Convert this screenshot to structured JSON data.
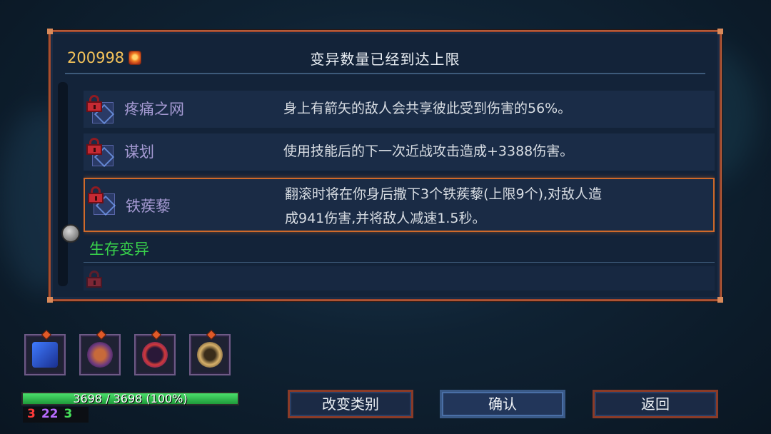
{
  "header": {
    "cells_count": "200998",
    "cell_icon": "cell-currency-icon",
    "title": "变异数量已经到达上限"
  },
  "mutations": [
    {
      "name": "疼痛之网",
      "description": "身上有箭矢的敌人会共享彼此受到伤害的56%。",
      "locked": true,
      "icon": "web-of-pain-icon"
    },
    {
      "name": "谋划",
      "description": "使用技能后的下一次近战攻击造成+3388伤害。",
      "locked": true,
      "icon": "scheme-icon"
    },
    {
      "name": "铁蒺藜",
      "description_line1": "翻滚时将在你身后撒下3个铁蒺藜(上限9个),对敌人造",
      "description_line2": "成941伤害,并将敌人减速1.5秒。",
      "locked": true,
      "selected": true,
      "icon": "caltrops-icon"
    }
  ],
  "category": {
    "label": "生存变异"
  },
  "scroll": {
    "position": 0.62
  },
  "hud": {
    "inventory": [
      {
        "icon": "blue-mutation-icon"
      },
      {
        "icon": "amulet-icon"
      },
      {
        "icon": "red-skill-icon"
      },
      {
        "icon": "gold-shield-icon"
      }
    ],
    "health_text": "3698 / 3698 (100%)",
    "health_fraction": 1.0,
    "stats": {
      "brutality": "3",
      "tactics": "22",
      "survival": "3"
    },
    "colors": {
      "brutality": "#ff3a3a",
      "tactics": "#b86cff",
      "survival": "#46e05a",
      "health": "#3ccf5a",
      "accent": "#a34a2e"
    }
  },
  "buttons": {
    "change_category": "改变类别",
    "confirm": "确认",
    "back": "返回"
  }
}
